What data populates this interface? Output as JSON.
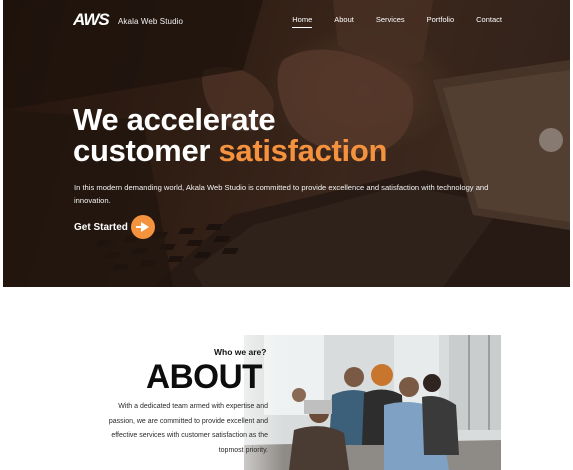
{
  "brand": {
    "logo_mark": "AWS",
    "name": "Akala Web Studio"
  },
  "nav": {
    "items": [
      {
        "label": "Home",
        "active": true
      },
      {
        "label": "About",
        "active": false
      },
      {
        "label": "Services",
        "active": false
      },
      {
        "label": "Portfolio",
        "active": false
      },
      {
        "label": "Contact",
        "active": false
      }
    ]
  },
  "hero": {
    "headline_line1": "We accelerate",
    "headline_line2_prefix": "customer ",
    "headline_line2_accent": "satisfaction",
    "description": "In this modern demanding world, Akala Web Studio is committed to provide excellence and satisfaction with technology and innovation.",
    "cta_label": "Get Started",
    "cta_icon": "arrow-right-icon"
  },
  "about": {
    "eyebrow": "Who we are?",
    "title": "ABOUT",
    "description": "With a dedicated team armed with expertise and passion, we are committed to provide excellent and effective services with customer satisfaction as the topmost priority."
  },
  "colors": {
    "accent": "#f5923e",
    "hero_text": "#ffffff",
    "dark_text": "#0d0d0d"
  }
}
